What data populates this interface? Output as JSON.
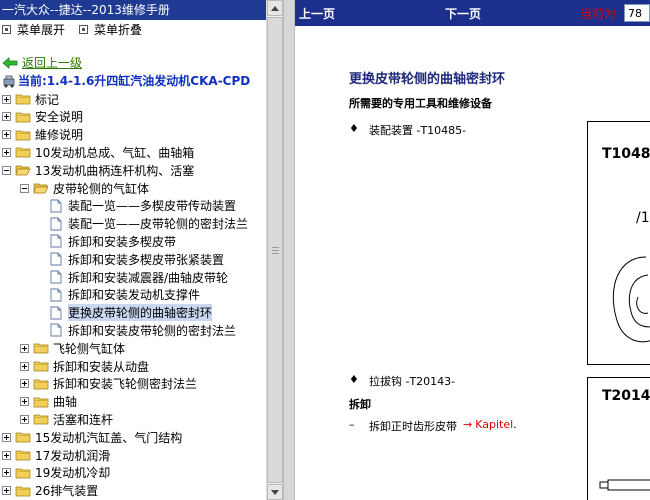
{
  "left_title": "一汽大众--捷达--2013维修手册",
  "menu": {
    "expand": "菜单展开",
    "collapse": "菜单折叠"
  },
  "back_label": "返回上一级",
  "current": "当前:1.4-1.6升四缸汽油发动机CKA-CPD",
  "tree": [
    {
      "label": "标记",
      "pm": "plus",
      "icon": "folder",
      "level": 0
    },
    {
      "label": "安全说明",
      "pm": "plus",
      "icon": "folder",
      "level": 0
    },
    {
      "label": "維修说明",
      "pm": "plus",
      "icon": "folder",
      "level": 0
    },
    {
      "label": "10发动机总成、气缸、曲轴箱",
      "pm": "plus",
      "icon": "folder",
      "level": 0
    },
    {
      "label": "13发动机曲柄连杆机构、活塞",
      "pm": "minus",
      "icon": "folder-open",
      "level": 0
    },
    {
      "label": "皮带轮侧的气缸体",
      "pm": "minus",
      "icon": "folder-open",
      "level": 1
    },
    {
      "label": "装配一览——多楔皮带传动装置",
      "pm": "",
      "icon": "doc",
      "level": 2
    },
    {
      "label": "装配一览——皮带轮侧的密封法兰",
      "pm": "",
      "icon": "doc",
      "level": 2
    },
    {
      "label": "拆卸和安装多楔皮带",
      "pm": "",
      "icon": "doc",
      "level": 2
    },
    {
      "label": "拆卸和安装多楔皮带张紧装置",
      "pm": "",
      "icon": "doc",
      "level": 2
    },
    {
      "label": "拆卸和安装减震器/曲轴皮带轮",
      "pm": "",
      "icon": "doc",
      "level": 2
    },
    {
      "label": "拆卸和安装发动机支撑件",
      "pm": "",
      "icon": "doc",
      "level": 2
    },
    {
      "label": "更换皮带轮侧的曲轴密封环",
      "pm": "",
      "icon": "doc",
      "level": 2,
      "selected": true
    },
    {
      "label": "拆卸和安装皮带轮侧的密封法兰",
      "pm": "",
      "icon": "doc",
      "level": 2
    },
    {
      "label": "飞轮侧气缸体",
      "pm": "plus",
      "icon": "folder",
      "level": 1
    },
    {
      "label": "拆卸和安装从动盘",
      "pm": "plus",
      "icon": "folder",
      "level": 1
    },
    {
      "label": "拆卸和安装飞轮侧密封法兰",
      "pm": "plus",
      "icon": "folder",
      "level": 1
    },
    {
      "label": "曲轴",
      "pm": "plus",
      "icon": "folder",
      "level": 1
    },
    {
      "label": "活塞和连杆",
      "pm": "plus",
      "icon": "folder",
      "level": 1
    },
    {
      "label": "15发动机汽缸盖、气门结构",
      "pm": "plus",
      "icon": "folder",
      "level": 0
    },
    {
      "label": "17发动机润滑",
      "pm": "plus",
      "icon": "folder",
      "level": 0
    },
    {
      "label": "19发动机冷却",
      "pm": "plus",
      "icon": "folder",
      "level": 0
    },
    {
      "label": "26排气装置",
      "pm": "plus",
      "icon": "folder",
      "level": 0
    }
  ],
  "nav": {
    "prev": "上一页",
    "next": "下一页",
    "current_label": "当前为",
    "page_value": "78"
  },
  "content": {
    "title": "更换皮带轮侧的曲轴密封环",
    "subtitle": "所需要的专用工具和维修设备",
    "bullet1_symbol": "♦",
    "bullet1": "装配装置 -T10485-",
    "tool1_label": "T1048",
    "tool1_sub": "/1",
    "bullet2_symbol": "♦",
    "bullet2": "拉拔钩 -T20143-",
    "tool2_label": "T2014",
    "section_remove": "拆卸",
    "step1_dash": "–",
    "step1_text": "拆卸正时齿形皮带",
    "step1_arrow": "→",
    "step1_link": "Kapitel",
    "step1_end": "."
  },
  "colors": {
    "title_bar": "#1f3a93",
    "nav_bar": "#1c2f8c",
    "accent_red": "#e00000",
    "back_green": "#2a7a00",
    "current_blue": "#1030c0"
  }
}
